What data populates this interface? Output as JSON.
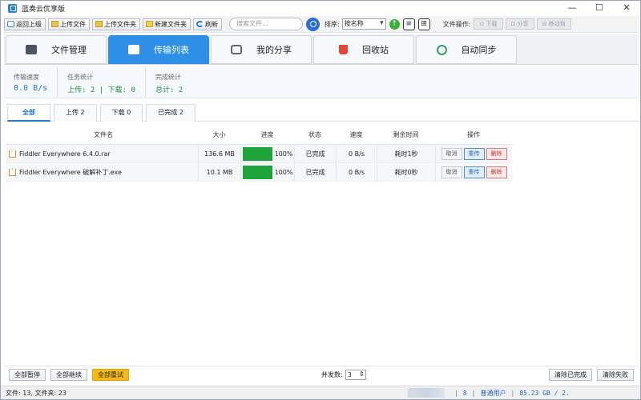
{
  "window": {
    "title": "蓝奏云优享版",
    "minimize": "—",
    "maximize": "☐",
    "close": "✕"
  },
  "toolbar": {
    "back": "返回上级",
    "upload_file": "上传文件",
    "upload_folder": "上传文件夹",
    "new_folder": "新建文件夹",
    "refresh": "刷新",
    "search_placeholder": "搜索文件...",
    "sort_label": "排序:",
    "sort_value": "按名称",
    "file_ops_label": "文件操作:",
    "op_download": "下载",
    "op_share": "分享",
    "op_move": "移动到"
  },
  "main_tabs": [
    {
      "label": "文件管理",
      "icon": "folder-icon",
      "active": false
    },
    {
      "label": "传输列表",
      "icon": "transfer-icon",
      "active": true
    },
    {
      "label": "我的分享",
      "icon": "share-icon",
      "active": false
    },
    {
      "label": "回收站",
      "icon": "trash-icon",
      "active": false
    },
    {
      "label": "自动同步",
      "icon": "sync-icon",
      "active": false
    }
  ],
  "stats": {
    "speed_label": "传输速度",
    "speed_value": "0.0 B/s",
    "task_label": "任务统计",
    "task_value": "上传: 2 | 下载: 0",
    "done_label": "完成统计",
    "done_value": "总计: 2"
  },
  "filter_tabs": [
    {
      "label": "全部",
      "active": true
    },
    {
      "label": "上传 2",
      "active": false
    },
    {
      "label": "下载 0",
      "active": false
    },
    {
      "label": "已完成 2",
      "active": false
    }
  ],
  "table": {
    "headers": {
      "name": "文件名",
      "size": "大小",
      "progress": "进度",
      "status": "状态",
      "speed": "速度",
      "remaining": "剩余时间",
      "ops": "操作"
    },
    "rows": [
      {
        "name": "Fiddler Everywhere 6.4.0.rar",
        "size": "136.6 MB",
        "progress_pct": 100,
        "progress_text": "100%",
        "status": "已完成",
        "speed": "0 B/s",
        "remaining": "耗时1秒",
        "op_cancel": "取消",
        "op_retry": "重传",
        "op_delete": "删除"
      },
      {
        "name": "Fiddler Everywhere 破解补丁.exe",
        "size": "10.1 MB",
        "progress_pct": 100,
        "progress_text": "100%",
        "status": "已完成",
        "speed": "0 B/s",
        "remaining": "耗时0秒",
        "op_cancel": "取消",
        "op_retry": "重传",
        "op_delete": "删除"
      }
    ]
  },
  "bottom": {
    "pause_all": "全部暂停",
    "resume_all": "全部继续",
    "retry_all": "全部重试",
    "concurrency_label": "并发数:",
    "concurrency_value": "3",
    "clear_done": "清除已完成",
    "clear_failed": "清除失败"
  },
  "statusbar": {
    "left": "文件: 13, 文件夹: 23",
    "seg1": "8",
    "user_type": "普通用户",
    "space": "85.23 GB / 2."
  },
  "colors": {
    "accent": "#2d8fe6",
    "progress": "#1da33a",
    "retry_all_bg": "#f6b917"
  }
}
